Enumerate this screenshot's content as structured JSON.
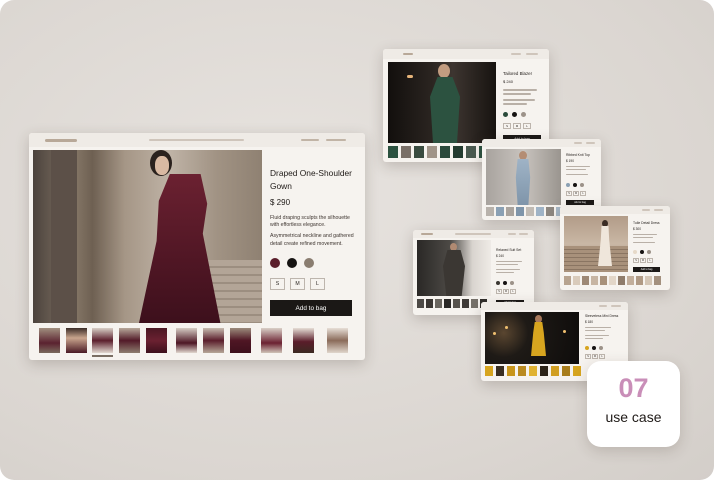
{
  "main_product": {
    "title": "Draped One-Shoulder Gown",
    "price": "$ 290",
    "description_1": "Fluid draping sculpts the silhouette with effortless elegance.",
    "description_2": "Asymmetrical neckline and gathered detail create refined movement.",
    "swatches": [
      "#5a1d2a",
      "#161312",
      "#8a7d70"
    ],
    "sizes": [
      "S",
      "M",
      "L"
    ],
    "cta": "Add to bag"
  },
  "cards": {
    "blazer": {
      "title": "Tailored Blazer",
      "price": "$ 240",
      "cta": "Add to bag",
      "sizes": [
        "S",
        "M",
        "L"
      ],
      "swatches": [
        "#2a4a3a",
        "#161312",
        "#9c9289"
      ]
    },
    "ribbed": {
      "title": "Ribbed Knit Top",
      "price": "$ 190",
      "cta": "Add to bag",
      "sizes": [
        "S",
        "M",
        "L"
      ],
      "swatches": [
        "#8aa0b4",
        "#161312",
        "#9c9289"
      ]
    },
    "tulle": {
      "title": "Tulle Detail Dress",
      "price": "$ 300",
      "cta": "Add to bag",
      "sizes": [
        "S",
        "M",
        "L"
      ],
      "swatches": [
        "#e6d9c8",
        "#161312",
        "#9c9289"
      ]
    },
    "suit": {
      "title": "Relaxed Suit Set",
      "price": "$ 240",
      "cta": "Add to bag",
      "sizes": [
        "S",
        "M",
        "L"
      ],
      "swatches": [
        "#3b3733",
        "#161312",
        "#9c9289"
      ]
    },
    "mini": {
      "title": "Sleeveless Mini Dress",
      "price": "$ 180",
      "cta": "Add to bag",
      "sizes": [
        "S",
        "M",
        "L"
      ],
      "swatches": [
        "#d7a51f",
        "#161312",
        "#9c9289"
      ]
    }
  },
  "badge": {
    "number": "07",
    "label": "use case"
  },
  "colors": {
    "accent": "#c98eb8",
    "button": "#1b1816",
    "card_bg": "#f6f3ef"
  }
}
